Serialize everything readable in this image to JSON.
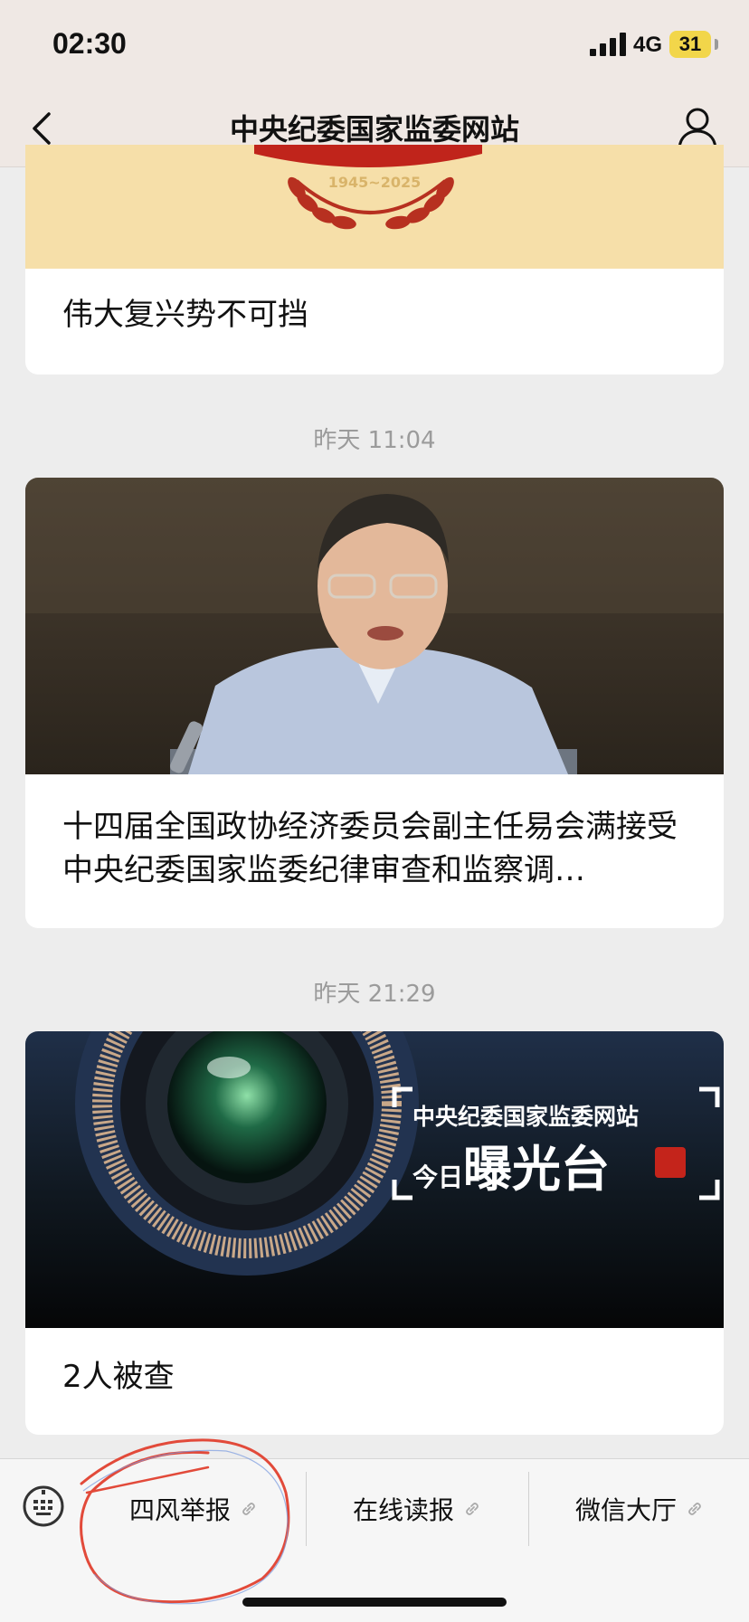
{
  "status_bar": {
    "time": "02:30",
    "network": "4G",
    "battery": "31"
  },
  "nav": {
    "title": "中央纪委国家监委网站"
  },
  "feed": {
    "card1": {
      "banner_text": "1945~2025",
      "title": "伟大复兴势不可挡"
    },
    "ts2": "昨天 11:04",
    "card2": {
      "title": "十四届全国政协经济委员会副主任易会满接受中央纪委国家监委纪律审查和监察调…"
    },
    "ts3": "昨天 21:29",
    "card3": {
      "overlay_line1": "中央纪委国家监委网站",
      "overlay_line2a": "今日",
      "overlay_line2b": "曝光台",
      "title": "2人被查"
    }
  },
  "menu": {
    "items": [
      "四风举报",
      "在线读报",
      "微信大厅"
    ]
  },
  "colors": {
    "nav_bg": "#efe8e4",
    "feed_bg": "#ededed",
    "annotation": "#e24a3a",
    "battery": "#f2d64a"
  }
}
